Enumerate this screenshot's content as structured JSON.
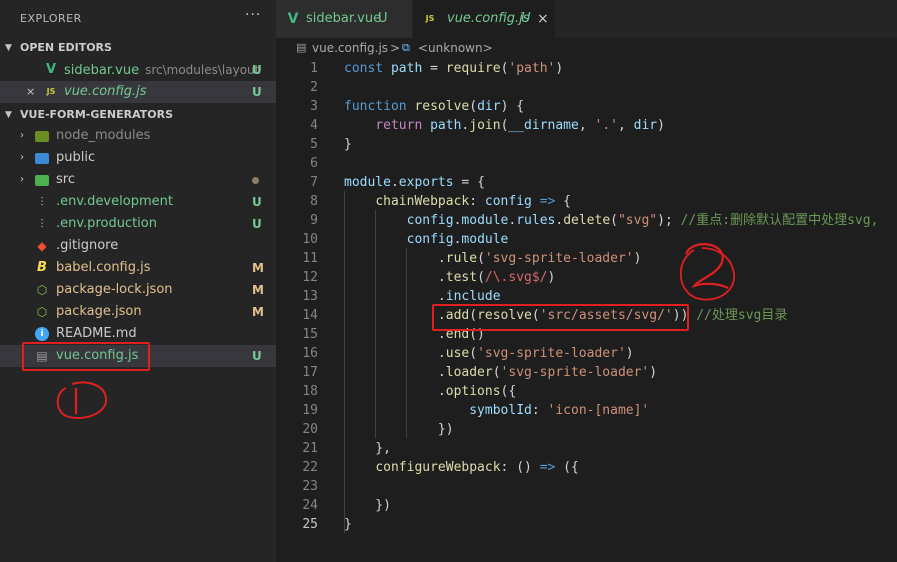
{
  "explorer": {
    "header": "EXPLORER",
    "more": "···",
    "open_editors_title": "OPEN EDITORS",
    "open_editors": [
      {
        "icon": "vue-file-icon",
        "icon_glyph": "V",
        "name": "sidebar.vue",
        "subpath": "src\\modules\\layout",
        "badge": "U"
      },
      {
        "icon": "js-file-icon",
        "icon_glyph": "JS",
        "name": "vue.config.js",
        "badge": "U",
        "close": "×"
      }
    ],
    "project_title": "VUE-FORM-GENERATORS",
    "tree": [
      {
        "name": "node_modules",
        "type": "folder",
        "chevron": "›",
        "icon": "node-modules-folder-icon"
      },
      {
        "name": "public",
        "type": "folder",
        "chevron": "›",
        "icon": "public-folder-icon"
      },
      {
        "name": "src",
        "type": "folder",
        "chevron": "›",
        "icon": "src-folder-icon"
      },
      {
        "name": ".env.development",
        "badge": "U",
        "icon": "env-file-icon"
      },
      {
        "name": ".env.production",
        "badge": "U",
        "icon": "env-file-icon"
      },
      {
        "name": ".gitignore",
        "icon": "git-icon"
      },
      {
        "name": "babel.config.js",
        "badge": "M",
        "icon": "babel-icon"
      },
      {
        "name": "package-lock.json",
        "badge": "M",
        "icon": "package-icon"
      },
      {
        "name": "package.json",
        "badge": "M",
        "icon": "package-icon"
      },
      {
        "name": "README.md",
        "icon": "info-icon"
      },
      {
        "name": "vue.config.js",
        "badge": "U",
        "icon": "vue-config-icon"
      }
    ]
  },
  "tabs": [
    {
      "label": "sidebar.vue",
      "badge": "U",
      "icon": "vue-file-icon",
      "icon_glyph": "V"
    },
    {
      "label": "vue.config.js",
      "badge": "U",
      "icon": "js-file-icon",
      "icon_glyph": "JS",
      "close": "×"
    }
  ],
  "breadcrumb": {
    "file": "vue.config.js",
    "sep": ">",
    "symbol": "<unknown>"
  },
  "editor": {
    "line_numbers": [
      "1",
      "2",
      "3",
      "4",
      "5",
      "6",
      "7",
      "8",
      "9",
      "10",
      "11",
      "12",
      "13",
      "14",
      "15",
      "16",
      "17",
      "18",
      "19",
      "20",
      "21",
      "22",
      "23",
      "24",
      "25"
    ],
    "lines": [
      [
        [
          "kw",
          "const"
        ],
        [
          "pn",
          " "
        ],
        [
          "var",
          "path"
        ],
        [
          "pn",
          " = "
        ],
        [
          "fn",
          "require"
        ],
        [
          "pn",
          "("
        ],
        [
          "str",
          "'path'"
        ],
        [
          "pn",
          ")"
        ]
      ],
      [],
      [
        [
          "kw",
          "function"
        ],
        [
          "pn",
          " "
        ],
        [
          "fn",
          "resolve"
        ],
        [
          "pn",
          "("
        ],
        [
          "var",
          "dir"
        ],
        [
          "pn",
          ") {"
        ]
      ],
      [
        [
          "pn",
          "    "
        ],
        [
          "kw2",
          "return"
        ],
        [
          "pn",
          " "
        ],
        [
          "var",
          "path"
        ],
        [
          "pn",
          "."
        ],
        [
          "fn",
          "join"
        ],
        [
          "pn",
          "("
        ],
        [
          "var",
          "__dirname"
        ],
        [
          "pn",
          ", "
        ],
        [
          "str",
          "'.'"
        ],
        [
          "pn",
          ", "
        ],
        [
          "var",
          "dir"
        ],
        [
          "pn",
          ")"
        ]
      ],
      [
        [
          "pn",
          "}"
        ]
      ],
      [],
      [
        [
          "var",
          "module"
        ],
        [
          "pn",
          "."
        ],
        [
          "var",
          "exports"
        ],
        [
          "pn",
          " = {"
        ]
      ],
      [
        [
          "pn",
          "    "
        ],
        [
          "fn",
          "chainWebpack"
        ],
        [
          "pn",
          ": "
        ],
        [
          "var",
          "config"
        ],
        [
          "pn",
          " "
        ],
        [
          "kw",
          "=>"
        ],
        [
          "pn",
          " {"
        ]
      ],
      [
        [
          "pn",
          "        "
        ],
        [
          "var",
          "config"
        ],
        [
          "pn",
          "."
        ],
        [
          "var",
          "module"
        ],
        [
          "pn",
          "."
        ],
        [
          "var",
          "rules"
        ],
        [
          "pn",
          "."
        ],
        [
          "fn",
          "delete"
        ],
        [
          "pn",
          "("
        ],
        [
          "str",
          "\"svg\""
        ],
        [
          "pn",
          "); "
        ],
        [
          "cm",
          "//重点:删除默认配置中处理svg,"
        ]
      ],
      [
        [
          "pn",
          "        "
        ],
        [
          "var",
          "config"
        ],
        [
          "pn",
          "."
        ],
        [
          "var",
          "module"
        ]
      ],
      [
        [
          "pn",
          "            ."
        ],
        [
          "fn",
          "rule"
        ],
        [
          "pn",
          "("
        ],
        [
          "str",
          "'svg-sprite-loader'"
        ],
        [
          "pn",
          ")"
        ]
      ],
      [
        [
          "pn",
          "            ."
        ],
        [
          "fn",
          "test"
        ],
        [
          "pn",
          "("
        ],
        [
          "rx",
          "/\\.svg$/"
        ],
        [
          "pn",
          ")"
        ]
      ],
      [
        [
          "pn",
          "            ."
        ],
        [
          "var",
          "include"
        ]
      ],
      [
        [
          "pn",
          "            ."
        ],
        [
          "fn",
          "add"
        ],
        [
          "pn",
          "("
        ],
        [
          "fn",
          "resolve"
        ],
        [
          "pn",
          "("
        ],
        [
          "str",
          "'src/assets/svg/'"
        ],
        [
          "pn",
          "))"
        ],
        [
          "cm",
          " //处理svg目录"
        ]
      ],
      [
        [
          "pn",
          "            ."
        ],
        [
          "fn",
          "end"
        ],
        [
          "pn",
          "()"
        ]
      ],
      [
        [
          "pn",
          "            ."
        ],
        [
          "fn",
          "use"
        ],
        [
          "pn",
          "("
        ],
        [
          "str",
          "'svg-sprite-loader'"
        ],
        [
          "pn",
          ")"
        ]
      ],
      [
        [
          "pn",
          "            ."
        ],
        [
          "fn",
          "loader"
        ],
        [
          "pn",
          "("
        ],
        [
          "str",
          "'svg-sprite-loader'"
        ],
        [
          "pn",
          ")"
        ]
      ],
      [
        [
          "pn",
          "            ."
        ],
        [
          "fn",
          "options"
        ],
        [
          "pn",
          "({"
        ]
      ],
      [
        [
          "pn",
          "                "
        ],
        [
          "var",
          "symbolId"
        ],
        [
          "pn",
          ": "
        ],
        [
          "str",
          "'icon-[name]'"
        ]
      ],
      [
        [
          "pn",
          "            })"
        ]
      ],
      [
        [
          "pn",
          "    },"
        ]
      ],
      [
        [
          "pn",
          "    "
        ],
        [
          "fn",
          "configureWebpack"
        ],
        [
          "pn",
          ": () "
        ],
        [
          "kw",
          "=>"
        ],
        [
          "pn",
          " ({"
        ]
      ],
      [],
      [
        [
          "pn",
          "    })"
        ]
      ],
      [
        [
          "pn",
          "}"
        ]
      ]
    ]
  },
  "colors": {
    "untracked": "#73c991",
    "modified": "#e2c08d",
    "vue": "#41b883",
    "js": "#cbcb41",
    "annotation": "#e02020"
  }
}
